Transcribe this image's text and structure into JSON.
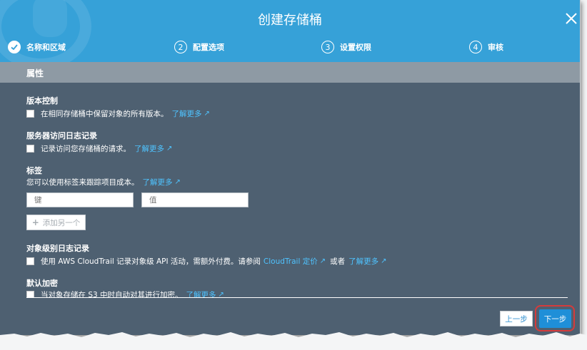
{
  "dialog": {
    "title": "创建存储桶",
    "close_icon": "close-icon"
  },
  "steps": [
    {
      "number": "",
      "label": "名称和区域",
      "status": "completed",
      "icon": "checkmark-icon"
    },
    {
      "number": "2",
      "label": "配置选项",
      "status": "current"
    },
    {
      "number": "3",
      "label": "设置权限",
      "status": "pending"
    },
    {
      "number": "4",
      "label": "审核",
      "status": "pending"
    }
  ],
  "section": {
    "title": "属性"
  },
  "versioning": {
    "heading": "版本控制",
    "checkbox_label": "在相同存储桶中保留对象的所有版本。",
    "link": "了解更多"
  },
  "access_logging": {
    "heading": "服务器访问日志记录",
    "checkbox_label": "记录访问您存储桶的请求。",
    "link": "了解更多"
  },
  "tags": {
    "heading": "标签",
    "description": "您可以使用标签来跟踪项目成本。",
    "link": "了解更多",
    "key_placeholder": "键",
    "value_placeholder": "值",
    "add_button": "添加另一个"
  },
  "object_logging": {
    "heading": "对象级别日志记录",
    "text_before": "使用 AWS CloudTrail 记录对象级 API 活动，需额外付费。请参阅",
    "pricing_link": "CloudTrail 定价",
    "text_or": "或者",
    "link": "了解更多"
  },
  "encryption": {
    "heading": "默认加密",
    "checkbox_label": "当对象存储在 S3 中时自动对其进行加密。",
    "link": "了解更多"
  },
  "footer": {
    "prev_button": "上一步",
    "next_button": "下一步"
  },
  "colors": {
    "header": "#36a1d8",
    "body": "#4e6071",
    "section_bar": "#8e9aa4",
    "link": "#4fc3ff",
    "primary_button": "#1f8fd8",
    "highlight_ring": "#d63b3b"
  }
}
